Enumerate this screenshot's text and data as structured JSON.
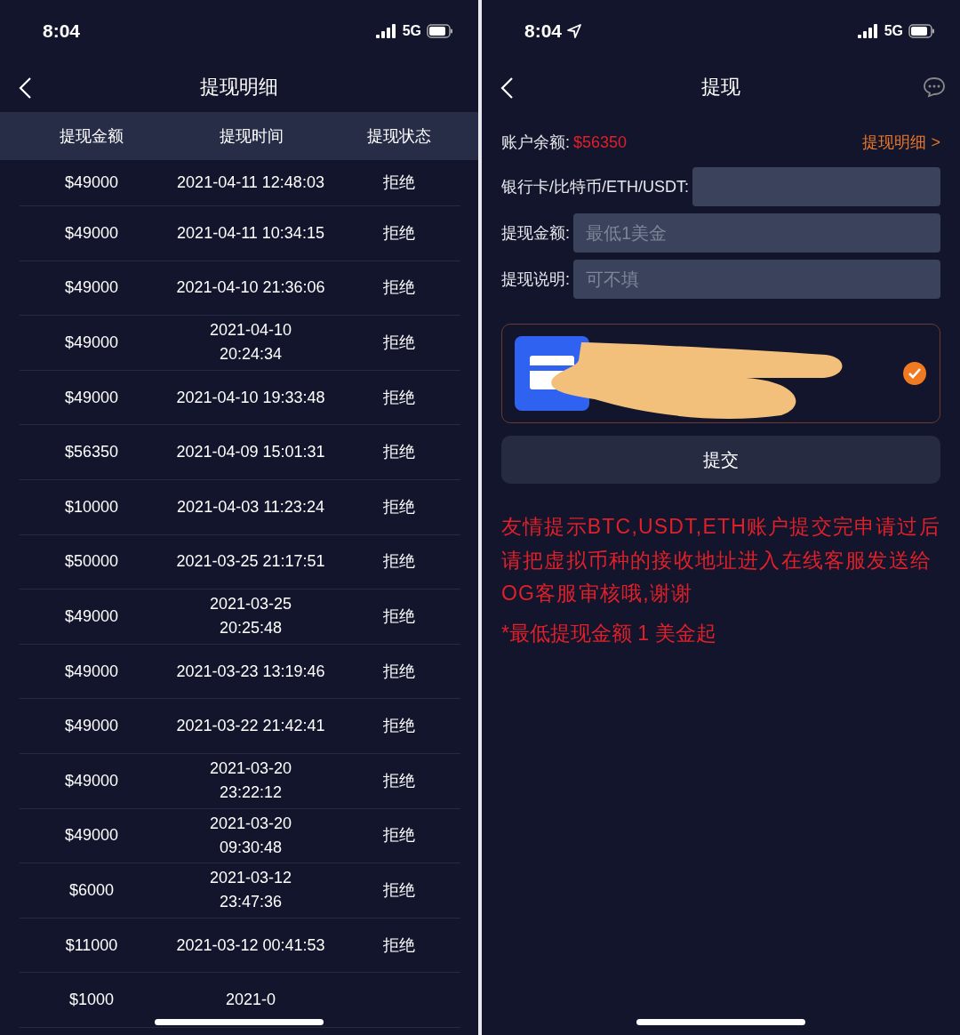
{
  "left_screen": {
    "status_bar": {
      "time": "8:04",
      "network": "5G"
    },
    "nav_bar": {
      "title": "提现明细"
    },
    "table": {
      "columns": [
        "提现金额",
        "提现时间",
        "提现状态"
      ],
      "rows": [
        {
          "amount": "$49000",
          "time": "2021-04-11 12:48:03",
          "wrapped": false,
          "status": "拒绝"
        },
        {
          "amount": "$49000",
          "time": "2021-04-11 10:34:15",
          "wrapped": false,
          "status": "拒绝"
        },
        {
          "amount": "$49000",
          "time": "2021-04-10 21:36:06",
          "wrapped": false,
          "status": "拒绝"
        },
        {
          "amount": "$49000",
          "time": "2021-04-10 20:24:34",
          "wrapped": true,
          "status": "拒绝"
        },
        {
          "amount": "$49000",
          "time": "2021-04-10 19:33:48",
          "wrapped": false,
          "status": "拒绝"
        },
        {
          "amount": "$56350",
          "time": "2021-04-09 15:01:31",
          "wrapped": false,
          "status": "拒绝"
        },
        {
          "amount": "$10000",
          "time": "2021-04-03 11:23:24",
          "wrapped": false,
          "status": "拒绝"
        },
        {
          "amount": "$50000",
          "time": "2021-03-25 21:17:51",
          "wrapped": false,
          "status": "拒绝"
        },
        {
          "amount": "$49000",
          "time": "2021-03-25 20:25:48",
          "wrapped": true,
          "status": "拒绝"
        },
        {
          "amount": "$49000",
          "time": "2021-03-23 13:19:46",
          "wrapped": false,
          "status": "拒绝"
        },
        {
          "amount": "$49000",
          "time": "2021-03-22 21:42:41",
          "wrapped": false,
          "status": "拒绝"
        },
        {
          "amount": "$49000",
          "time": "2021-03-20 23:22:12",
          "wrapped": true,
          "status": "拒绝"
        },
        {
          "amount": "$49000",
          "time": "2021-03-20 09:30:48",
          "wrapped": true,
          "status": "拒绝"
        },
        {
          "amount": "$6000",
          "time": "2021-03-12 23:47:36",
          "wrapped": true,
          "status": "拒绝"
        },
        {
          "amount": "$11000",
          "time": "2021-03-12 00:41:53",
          "wrapped": false,
          "status": "拒绝"
        },
        {
          "amount": "$1000",
          "time": "2021-0"
        }
      ]
    }
  },
  "right_screen": {
    "status_bar": {
      "time": "8:04",
      "network": "5G"
    },
    "nav_bar": {
      "title": "提现"
    },
    "balance": {
      "label": "账户余额:",
      "value": "$56350",
      "link": "提现明细 >"
    },
    "fields": [
      {
        "label": "银行卡/比特币/ETH/USDT:"
      },
      {
        "label": "提现金额:",
        "placeholder": "最低1美金"
      },
      {
        "label": "提现说明:",
        "placeholder": "可不填"
      }
    ],
    "account_card": {
      "checked": true
    },
    "submit_button": "提交",
    "notice": "友情提示BTC,USDT,ETH账户提交完申请过后请把虚拟币种的接收地址进入在线客服发送给OG客服审核哦,谢谢",
    "minimum_note": "*最低提现金额 1 美金起"
  }
}
